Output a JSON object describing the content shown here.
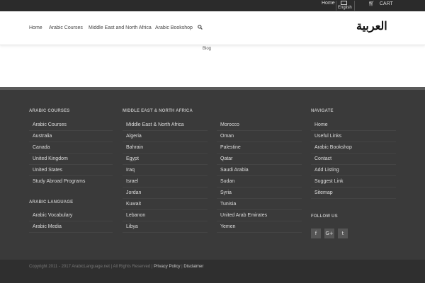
{
  "topbar": {
    "home": "Home",
    "language": "English",
    "cart": "CART",
    "cart_icon": "cart-icon"
  },
  "header": {
    "logo_text": "العربية",
    "nav": [
      "Home",
      "Arabic Courses",
      "Middle East and North Africa",
      "Arabic Bookshop"
    ],
    "search_icon": "search-icon"
  },
  "breadcrumb": "Blog",
  "footer": {
    "arabic_courses": {
      "title": "ARABIC COURSES",
      "links": [
        "Arabic Courses",
        "Australia",
        "Canada",
        "United Kingdom",
        "United States",
        "Study Abroad Programs"
      ]
    },
    "arabic_language": {
      "title": "ARABIC LANGUAGE",
      "links": [
        "Arabic Vocabulary",
        "Arabic Media"
      ]
    },
    "mena": {
      "title": "MIDDLE EAST & NORTH AFRICA",
      "col1": [
        "Middle East & North Africa",
        "Algeria",
        "Bahrain",
        "Egypt",
        "Iraq",
        "Israel",
        "Jordan",
        "Kuwait",
        "Lebanon",
        "Libya"
      ],
      "col2": [
        "Morocco",
        "Oman",
        "Palestine",
        "Qatar",
        "Saudi Arabia",
        "Sudan",
        "Syria",
        "Tunisia",
        "United Arab Emirates",
        "Yemen"
      ]
    },
    "navigate": {
      "title": "NAVIGATE",
      "links": [
        "Home",
        "Useful Links",
        "Arabic Bookshop",
        "Contact",
        "Add Listing",
        "Suggest Link",
        "Sitemap"
      ]
    },
    "follow": {
      "title": "FOLLOW US",
      "icons": [
        "facebook-icon",
        "google-plus-icon",
        "twitter-icon"
      ],
      "glyphs": [
        "f",
        "G+",
        "t"
      ]
    }
  },
  "bottom": {
    "copyright": "Copyright 2011 - 2017 ArabicLanguage.net | All Rights Reserved |",
    "privacy": "Privacy Policy",
    "sep": "|",
    "disclaimer": "Disclaimer"
  }
}
